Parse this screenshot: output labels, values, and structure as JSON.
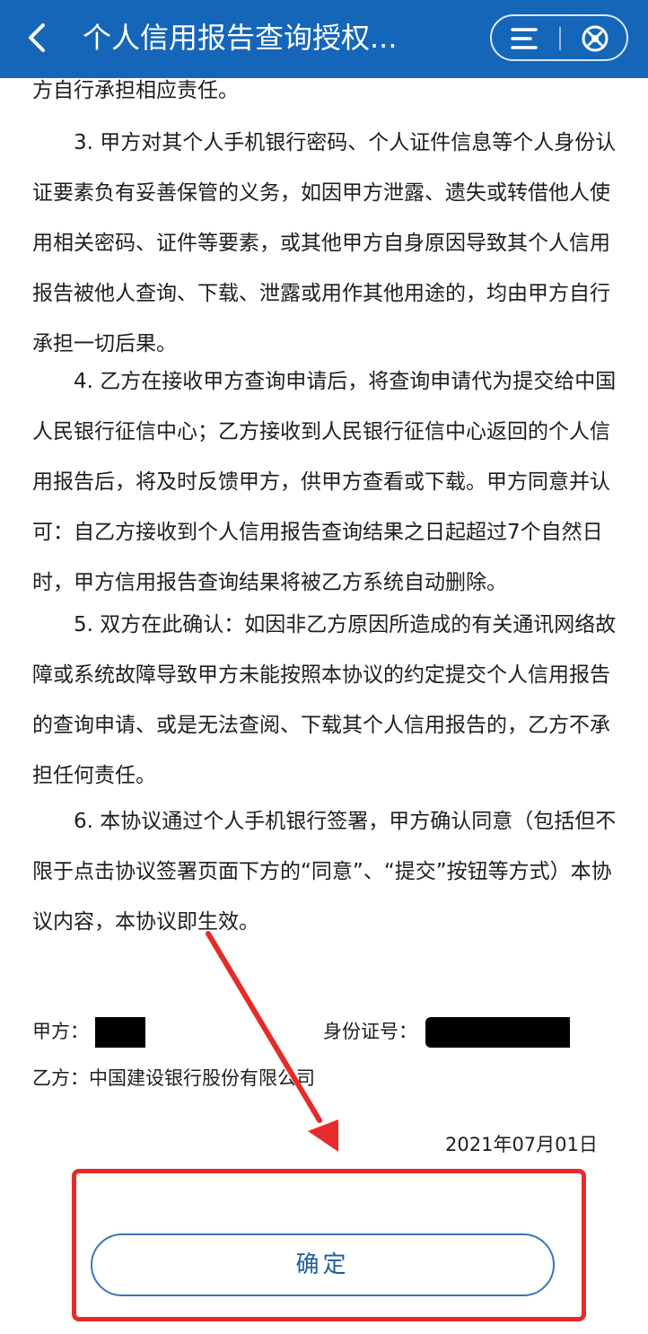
{
  "header": {
    "title": "个人信用报告查询授权...",
    "back_icon": "chevron-left-icon",
    "menu_icon": "hamburger-menu-icon",
    "close_icon": "close-circle-icon",
    "bar_color": "#1566b8"
  },
  "agreement": {
    "paragraphs": [
      "方自行承担相应责任。",
      "3. 甲方对其个人手机银行密码、个人证件信息等个人身份认证要素负有妥善保管的义务，如因甲方泄露、遗失或转借他人使用相关密码、证件等要素，或其他甲方自身原因导致其个人信用报告被他人查询、下载、泄露或用作其他用途的，均由甲方自行承担一切后果。",
      "4. 乙方在接收甲方查询申请后，将查询申请代为提交给中国人民银行征信中心；乙方接收到人民银行征信中心返回的个人信用报告后，将及时反馈甲方，供甲方查看或下载。甲方同意并认可：自乙方接收到个人信用报告查询结果之日起超过7个自然日时，甲方信用报告查询结果将被乙方系统自动删除。",
      "5. 双方在此确认：如因非乙方原因所造成的有关通讯网络故障或系统故障导致甲方未能按照本协议的约定提交个人信用报告的查询申请、或是无法查阅、下载其个人信用报告的，乙方不承担任何责任。",
      "6. 本协议通过个人手机银行签署，甲方确认同意（包括但不限于点击协议签署页面下方的“同意”、“提交”按钮等方式）本协议内容，本协议即生效。"
    ]
  },
  "signature": {
    "party_a_label": "甲方：",
    "id_label": "身份证号：",
    "party_b": "乙方：中国建设银行股份有限公司",
    "date": "2021年07月01日"
  },
  "footer": {
    "confirm_label": "确定",
    "highlight_color": "#e62b2b"
  }
}
